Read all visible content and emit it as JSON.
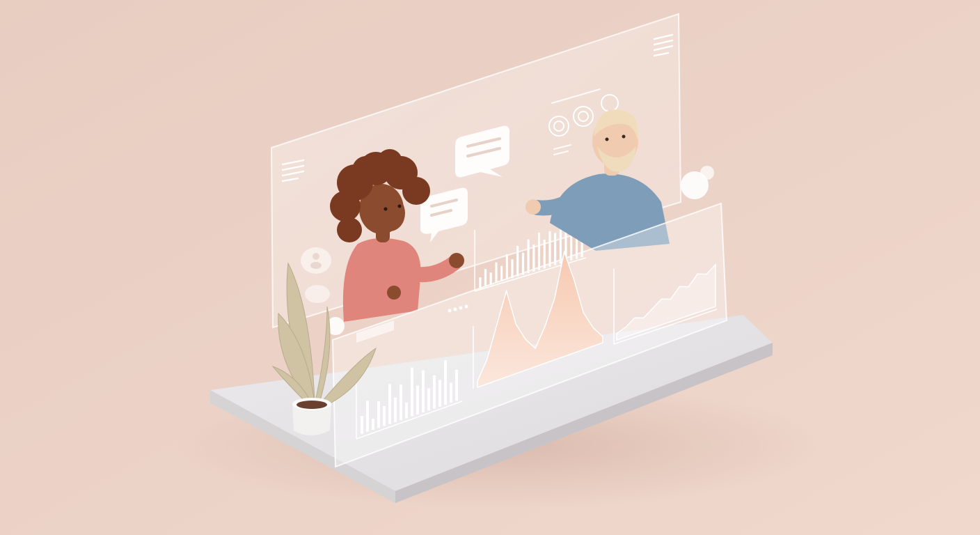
{
  "scene": {
    "background_color": "#ecd2c6",
    "base_color": "#e3e1e3",
    "glass_tint": "#f6eeea",
    "female_top_color": "#e0857c",
    "male_top_color": "#7e9db8",
    "hair_female": "#7a3a22",
    "hair_male": "#f0dcbb",
    "skin_female": "#8a4b2f",
    "skin_male": "#f1cbb0",
    "plant_color": "#cfc3a4",
    "area_fill": "#f6d2bf",
    "icons": [
      "menu-lines-icon",
      "chat-bubble-icon",
      "user-icon",
      "circle-badge-icon",
      "plant-decor-icon"
    ]
  },
  "chart_data": [
    {
      "type": "bar",
      "values": [
        6,
        10,
        7,
        12,
        9,
        15,
        11,
        18,
        13,
        20,
        16,
        22,
        17,
        21,
        19,
        23,
        18,
        20,
        14,
        17
      ]
    },
    {
      "type": "bar",
      "values": [
        8,
        14,
        5,
        12,
        9,
        18,
        11,
        16,
        7,
        22,
        13,
        19,
        10,
        15,
        12,
        20,
        9,
        14
      ]
    },
    {
      "type": "area",
      "values": [
        1,
        4,
        9,
        14,
        8,
        5,
        3,
        6,
        10,
        17,
        12,
        6,
        3,
        1
      ]
    },
    {
      "type": "area",
      "values": [
        2,
        3,
        5,
        4,
        6,
        8,
        7,
        10,
        9,
        12,
        11,
        13
      ]
    }
  ]
}
